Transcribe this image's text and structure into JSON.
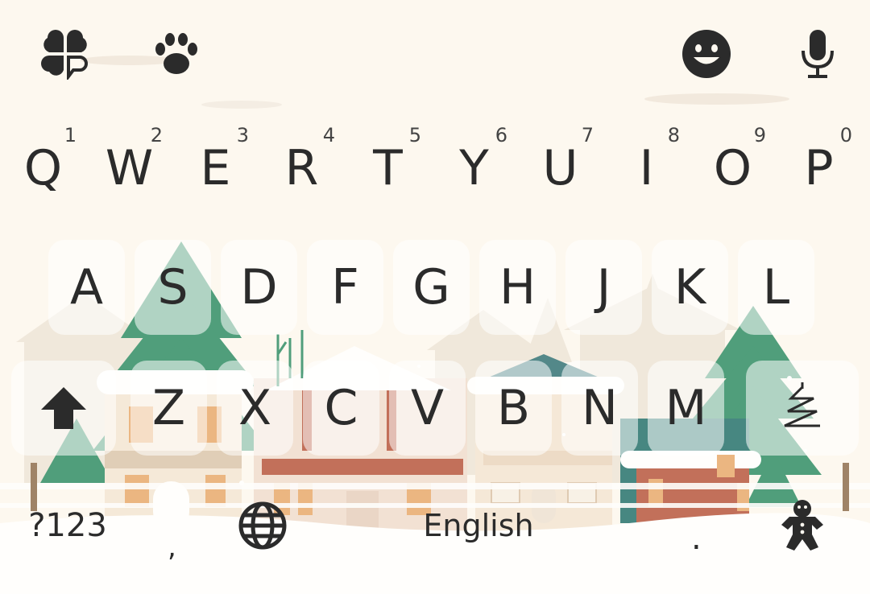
{
  "toolbar": {
    "left_icons": [
      "clover-icon",
      "paw-icon"
    ],
    "right_icons": [
      "emoji-icon",
      "mic-icon"
    ]
  },
  "rows": {
    "row1": [
      {
        "label": "Q",
        "hint": "1"
      },
      {
        "label": "W",
        "hint": "2"
      },
      {
        "label": "E",
        "hint": "3"
      },
      {
        "label": "R",
        "hint": "4"
      },
      {
        "label": "T",
        "hint": "5"
      },
      {
        "label": "Y",
        "hint": "6"
      },
      {
        "label": "U",
        "hint": "7"
      },
      {
        "label": "I",
        "hint": "8"
      },
      {
        "label": "O",
        "hint": "9"
      },
      {
        "label": "P",
        "hint": "0"
      }
    ],
    "row2": [
      "A",
      "S",
      "D",
      "F",
      "G",
      "H",
      "J",
      "K",
      "L"
    ],
    "row3": [
      "Z",
      "X",
      "C",
      "V",
      "B",
      "N",
      "M"
    ]
  },
  "bottom": {
    "symbols_label": "?123",
    "comma_label": ",",
    "space_label": "English",
    "period_label": "."
  },
  "colors": {
    "background": "#fdf8f0",
    "text": "#2b2b2b",
    "tree_green": "#2a8a62",
    "roof_snow": "#ffffff",
    "house_red": "#b5523a"
  }
}
